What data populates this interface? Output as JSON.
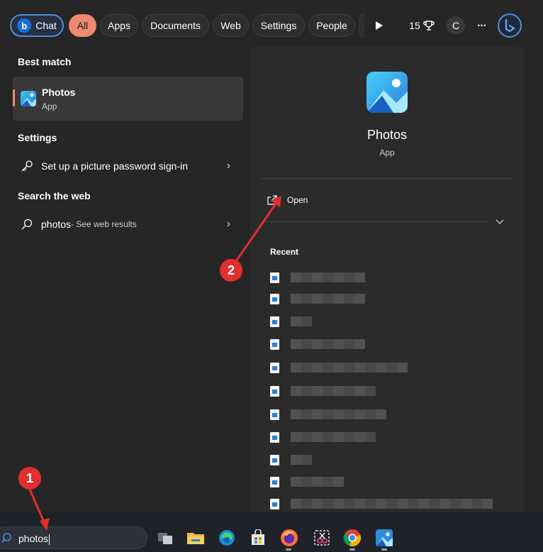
{
  "filters": {
    "chat": "Chat",
    "all": "All",
    "apps": "Apps",
    "documents": "Documents",
    "web": "Web",
    "settings": "Settings",
    "people": "People",
    "points": "15",
    "avatar_initial": "C",
    "more": "•••"
  },
  "left": {
    "best_match_title": "Best match",
    "best_match": {
      "name": "Photos",
      "type": "App"
    },
    "settings_title": "Settings",
    "settings_item": "Set up a picture password sign-in",
    "web_title": "Search the web",
    "web_item": {
      "query": "photos",
      "suffix": " - See web results"
    }
  },
  "preview": {
    "name": "Photos",
    "type": "App",
    "open_label": "Open",
    "recent_title": "Recent",
    "recent_items": [
      {
        "redacted": true
      },
      {
        "redacted": true
      },
      {
        "redacted": true
      },
      {
        "redacted": true
      },
      {
        "redacted": true
      },
      {
        "redacted": true
      },
      {
        "redacted": true
      },
      {
        "redacted": true
      },
      {
        "redacted": true
      },
      {
        "redacted": true
      },
      {
        "redacted": true
      }
    ]
  },
  "taskbar": {
    "search_value": "photos",
    "apps": [
      "task-view-icon",
      "file-explorer-icon",
      "edge-icon",
      "store-icon",
      "firefox-icon",
      "snipping-tool-icon",
      "chrome-icon",
      "photos-icon"
    ]
  },
  "annotations": {
    "step1": "1",
    "step2": "2"
  },
  "colors": {
    "accent": "#ef8a72",
    "bing": "#4f8ee0",
    "annotation": "#e0302e"
  }
}
